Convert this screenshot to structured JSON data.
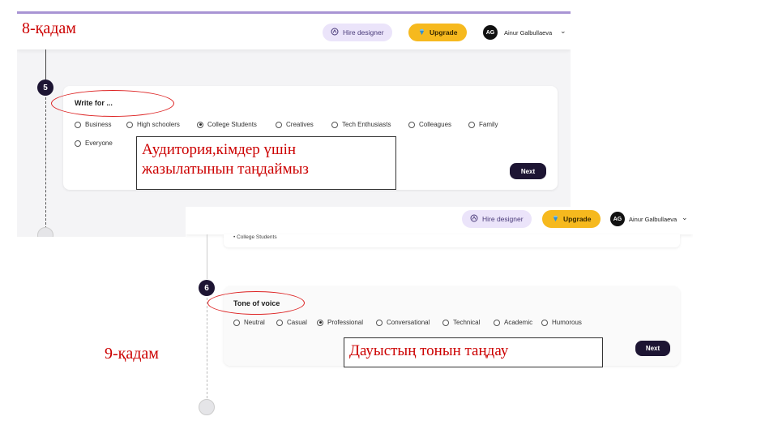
{
  "screenshot_top": {
    "step_label": "8-қадам",
    "header": {
      "hire_label": "Hire designer",
      "upgrade_label": "Upgrade",
      "avatar_initials": "AG",
      "user_name": "Ainur Galbullaeva"
    },
    "step_number": "5",
    "card_title": "Write for ...",
    "options": [
      {
        "label": "Business",
        "selected": false
      },
      {
        "label": "High schoolers",
        "selected": false
      },
      {
        "label": "College Students",
        "selected": true
      },
      {
        "label": "Creatives",
        "selected": false
      },
      {
        "label": "Tech Enthusiasts",
        "selected": false
      },
      {
        "label": "Colleagues",
        "selected": false
      },
      {
        "label": "Family",
        "selected": false
      },
      {
        "label": "Everyone",
        "selected": false
      }
    ],
    "next_label": "Next",
    "note": "Аудитория,кімдер үшін жазылатынын таңдаймыз"
  },
  "screenshot_bottom": {
    "step_label": "9-қадам",
    "header": {
      "hire_label": "Hire designer",
      "upgrade_label": "Upgrade",
      "avatar_initials": "AG",
      "user_name": "Ainur Galbullaeva"
    },
    "prev_summary": "• College Students",
    "step_number": "6",
    "card_title": "Tone of voice",
    "options": [
      {
        "label": "Neutral",
        "selected": false
      },
      {
        "label": "Casual",
        "selected": false
      },
      {
        "label": "Professional",
        "selected": true
      },
      {
        "label": "Conversational",
        "selected": false
      },
      {
        "label": "Technical",
        "selected": false
      },
      {
        "label": "Academic",
        "selected": false
      },
      {
        "label": "Humorous",
        "selected": false
      }
    ],
    "next_label": "Next",
    "note": "Дауыстың тонын таңдау"
  },
  "colors": {
    "accent": "#a894d4",
    "upgrade": "#f6b91e",
    "dark": "#1d1533",
    "annotation_red": "#cc0000"
  }
}
